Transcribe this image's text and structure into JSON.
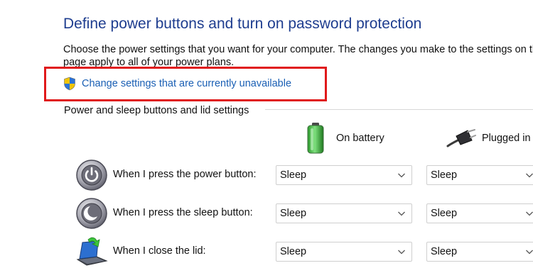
{
  "header": {
    "title": "Define power buttons and turn on password protection",
    "description_line1": "Choose the power settings that you want for your computer. The changes you make to the settings on this",
    "description_line2": "page apply to all of your power plans."
  },
  "change_settings_link": {
    "label": "Change settings that are currently unavailable",
    "icon": "uac-shield-icon"
  },
  "power_sleep_group": {
    "label": "Power and sleep buttons and lid settings",
    "columns": {
      "battery": "On battery",
      "plugged": "Plugged in"
    },
    "rows": [
      {
        "label": "When I press the power button:",
        "battery": "Sleep",
        "plugged": "Sleep",
        "icon": "power-button-icon"
      },
      {
        "label": "When I press the sleep button:",
        "battery": "Sleep",
        "plugged": "Sleep",
        "icon": "sleep-button-icon"
      },
      {
        "label": "When I close the lid:",
        "battery": "Sleep",
        "plugged": "Sleep",
        "icon": "laptop-lid-icon"
      }
    ]
  },
  "colors": {
    "title": "#1e3d8f",
    "link": "#1a5fb4",
    "highlight_border": "#e0191b",
    "battery_green": "#3fb23f"
  }
}
